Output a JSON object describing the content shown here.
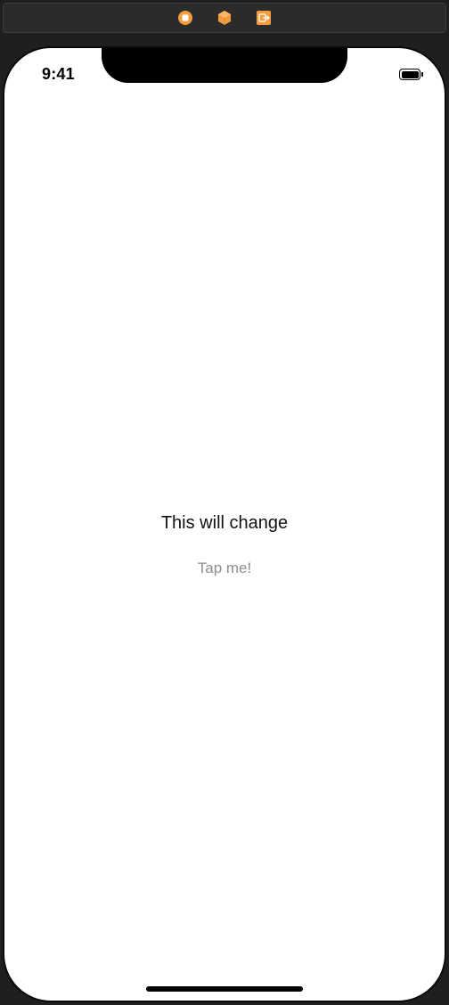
{
  "scene_dock": {
    "icons": [
      "view-controller-icon",
      "first-responder-icon",
      "exit-icon"
    ],
    "accent_color": "#f39c3c"
  },
  "status_bar": {
    "time": "9:41",
    "battery_level": 1.0
  },
  "content": {
    "label_text": "This will change",
    "button_label": "Tap me!"
  },
  "colors": {
    "label": "#111111",
    "button": "#8e8e93",
    "background": "#ffffff"
  }
}
